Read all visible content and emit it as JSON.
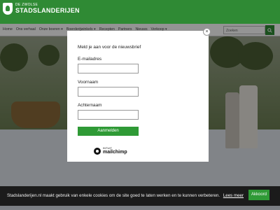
{
  "header": {
    "logo_small": "DE ZWOLSE",
    "logo_big": "STADSLANDERIJEN"
  },
  "nav": {
    "items": [
      "Home",
      "Ons verhaal",
      "Onze boeren ▾",
      "Boerderijwinkels ▾",
      "Recepten",
      "Partners",
      "Nieuws",
      "Verkoop ▾"
    ],
    "search_placeholder": "Zoeken"
  },
  "modal": {
    "title": "Meld je aan voor de nieuwsbrief",
    "email_label": "E-mailadres",
    "email_value": "",
    "firstname_label": "Voornaam",
    "firstname_value": "",
    "lastname_label": "Achternaam",
    "lastname_value": "",
    "submit_label": "Aanmelden",
    "close_symbol": "×",
    "mailchimp_small": "INTUIT",
    "mailchimp_big": "mailchimp"
  },
  "cookie": {
    "text": "Stadslanderijen.nl maakt gebruik van enkele cookies om de site goed te laten werken en te kunnen verbeteren.",
    "link": "Lees meer",
    "accept": "Akkoord"
  },
  "colors": {
    "brand_green": "#2f8a34",
    "button_green": "#2f9a36",
    "cookie_bg": "#1b1b1b"
  },
  "icons": [
    "logo-shield-icon",
    "search-icon",
    "close-icon",
    "mailchimp-icon"
  ]
}
